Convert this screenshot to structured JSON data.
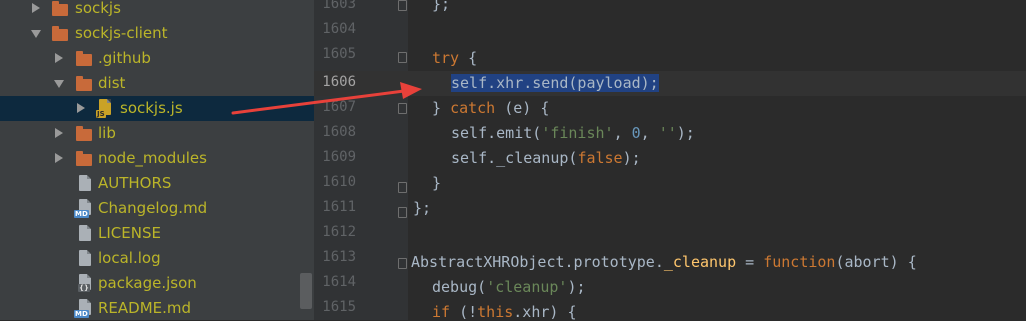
{
  "project_tree": {
    "items": [
      {
        "label": "sockjs",
        "kind": "folder",
        "depth": 1,
        "expanded": false
      },
      {
        "label": "sockjs-client",
        "kind": "folder",
        "depth": 1,
        "expanded": true
      },
      {
        "label": ".github",
        "kind": "folder",
        "depth": 2,
        "expanded": false
      },
      {
        "label": "dist",
        "kind": "folder",
        "depth": 2,
        "expanded": true
      },
      {
        "label": "sockjs.js",
        "kind": "file-js",
        "depth": 3,
        "selected": true
      },
      {
        "label": "lib",
        "kind": "folder",
        "depth": 2,
        "expanded": false
      },
      {
        "label": "node_modules",
        "kind": "folder",
        "depth": 2,
        "expanded": false
      },
      {
        "label": "AUTHORS",
        "kind": "file",
        "depth": 2
      },
      {
        "label": "Changelog.md",
        "kind": "file-md",
        "depth": 2
      },
      {
        "label": "LICENSE",
        "kind": "file",
        "depth": 2
      },
      {
        "label": "local.log",
        "kind": "file",
        "depth": 2
      },
      {
        "label": "package.json",
        "kind": "file-json",
        "depth": 2
      },
      {
        "label": "README.md",
        "kind": "file-md",
        "depth": 2
      }
    ],
    "badges": {
      "js": "JS",
      "md": "MD",
      "json": "{}"
    }
  },
  "editor": {
    "current_line": "1606",
    "lines": [
      {
        "no": "1603",
        "code": "};"
      },
      {
        "no": "1604",
        "code": ""
      },
      {
        "no": "1605",
        "code": "try {"
      },
      {
        "no": "1606",
        "code": "self.xhr.send(payload);"
      },
      {
        "no": "1607",
        "code": "} catch (e) {"
      },
      {
        "no": "1608",
        "code": "self.emit('finish', 0, '');"
      },
      {
        "no": "1609",
        "code": "self._cleanup(false);"
      },
      {
        "no": "1610",
        "code": "}"
      },
      {
        "no": "1611",
        "code": "};"
      },
      {
        "no": "1612",
        "code": ""
      },
      {
        "no": "1613",
        "code": "AbstractXHRObject.prototype._cleanup = function(abort) {"
      },
      {
        "no": "1614",
        "code": "debug('cleanup');"
      },
      {
        "no": "1615",
        "code": "if (!this.xhr) {"
      }
    ]
  },
  "colors": {
    "tree_background": "#3c3f41",
    "tree_text": "#bbb529",
    "selection_row": "#0d293e",
    "editor_background": "#2b2b2b",
    "keyword": "#cc7832",
    "string": "#6a8759",
    "function": "#ffc66d",
    "selection_text": "#214283",
    "annotation_arrow": "#e8413a"
  }
}
